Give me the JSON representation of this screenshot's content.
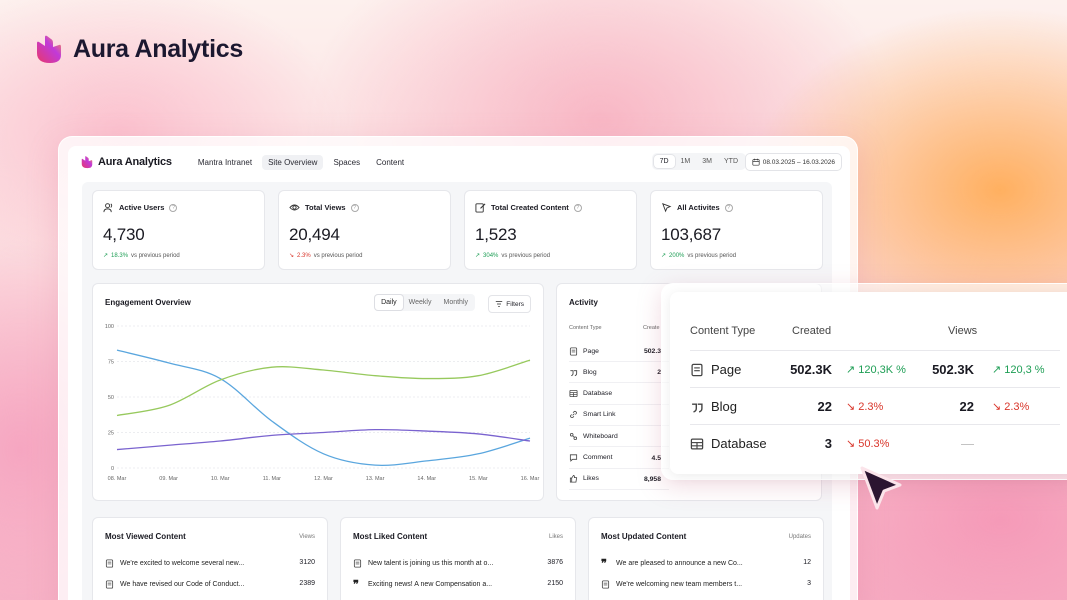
{
  "brand": {
    "name": "Aura Analytics"
  },
  "app": {
    "name": "Aura Analytics",
    "nav": [
      "Mantra Intranet",
      "Site Overview",
      "Spaces",
      "Content"
    ],
    "range": [
      "7D",
      "1M",
      "3M",
      "YTD"
    ],
    "date_range": "08.03.2025 – 16.03.2026"
  },
  "stats": [
    {
      "title": "Active Users",
      "value": "4,730",
      "change": "18.3%",
      "dir": "up",
      "note": "vs previous period"
    },
    {
      "title": "Total Views",
      "value": "20,494",
      "change": "2.3%",
      "dir": "down",
      "note": "vs previous period"
    },
    {
      "title": "Total Created Content",
      "value": "1,523",
      "change": "304%",
      "dir": "up",
      "note": "vs previous period"
    },
    {
      "title": "All Activites",
      "value": "103,687",
      "change": "200%",
      "dir": "up",
      "note": "vs previous period"
    }
  ],
  "engagement": {
    "title": "Engagement Overview",
    "tabs": [
      "Daily",
      "Weekly",
      "Monthly"
    ],
    "filters_label": "Filters"
  },
  "chart_data": {
    "type": "line",
    "title": "Engagement Overview",
    "x": [
      "08. Mar",
      "09. Mar",
      "10. Mar",
      "11. Mar",
      "12. Mar",
      "13. Mar",
      "14. Mar",
      "15. Mar",
      "16. Mar"
    ],
    "y_ticks": [
      "100",
      "75",
      "50",
      "25",
      "0"
    ],
    "ylim": [
      0,
      100
    ],
    "grid": true,
    "series": [
      {
        "color": "#5aa6de",
        "values": [
          83,
          74,
          63,
          33,
          10,
          2,
          5,
          10,
          21
        ]
      },
      {
        "color": "#97c95d",
        "values": [
          37,
          44,
          62,
          71,
          69,
          65,
          63,
          65,
          76
        ]
      },
      {
        "color": "#7a63cf",
        "values": [
          13,
          16,
          19,
          23,
          25,
          27,
          26,
          24,
          19
        ]
      }
    ]
  },
  "activity": {
    "title": "Activity",
    "col_type": "Content Type",
    "col_created": "Create",
    "rows": [
      {
        "label": "Page",
        "icon": "page-icon",
        "value": "502.3"
      },
      {
        "label": "Blog",
        "icon": "quote-icon",
        "value": "2"
      },
      {
        "label": "Database",
        "icon": "table-icon",
        "value": ""
      },
      {
        "label": "Smart Link",
        "icon": "link-icon",
        "value": ""
      },
      {
        "label": "Whiteboard",
        "icon": "whiteboard-icon",
        "value": ""
      },
      {
        "label": "Comment",
        "icon": "comment-icon",
        "value": "4.5"
      },
      {
        "label": "Likes",
        "icon": "thumb-icon",
        "value": "8,958"
      }
    ]
  },
  "lists": [
    {
      "title": "Most Viewed Content",
      "col": "Views",
      "items": [
        {
          "icon": "page-icon",
          "text": "We're excited to welcome several new...",
          "value": "3120"
        },
        {
          "icon": "page-icon",
          "text": "We have revised our Code of Conduct...",
          "value": "2389"
        }
      ]
    },
    {
      "title": "Most Liked Content",
      "col": "Likes",
      "items": [
        {
          "icon": "page-icon",
          "text": "New talent is joining us this month at o...",
          "value": "3876"
        },
        {
          "icon": "quote-icon",
          "text": "Exciting news! A new Compensation a...",
          "value": "2150"
        }
      ]
    },
    {
      "title": "Most Updated Content",
      "col": "Updates",
      "items": [
        {
          "icon": "quote-icon",
          "text": "We are pleased to announce a new Co...",
          "value": "12"
        },
        {
          "icon": "page-icon",
          "text": "We're welcoming new team members t...",
          "value": "3"
        }
      ]
    }
  ],
  "popup": {
    "headers": {
      "type": "Content Type",
      "created": "Created",
      "views": "Views"
    },
    "rows": [
      {
        "label": "Page",
        "icon": "page-icon",
        "created": "502.3K",
        "created_change": "120,3K %",
        "created_dir": "up",
        "views": "502.3K",
        "views_change": "120,3 %",
        "views_dir": "up"
      },
      {
        "label": "Blog",
        "icon": "quote-icon",
        "created": "22",
        "created_change": "2.3%",
        "created_dir": "down",
        "views": "22",
        "views_change": "2.3%",
        "views_dir": "down"
      },
      {
        "label": "Database",
        "icon": "table-icon",
        "created": "3",
        "created_change": "50.3%",
        "created_dir": "down",
        "views": "—",
        "views_change": "",
        "views_dir": ""
      }
    ]
  }
}
